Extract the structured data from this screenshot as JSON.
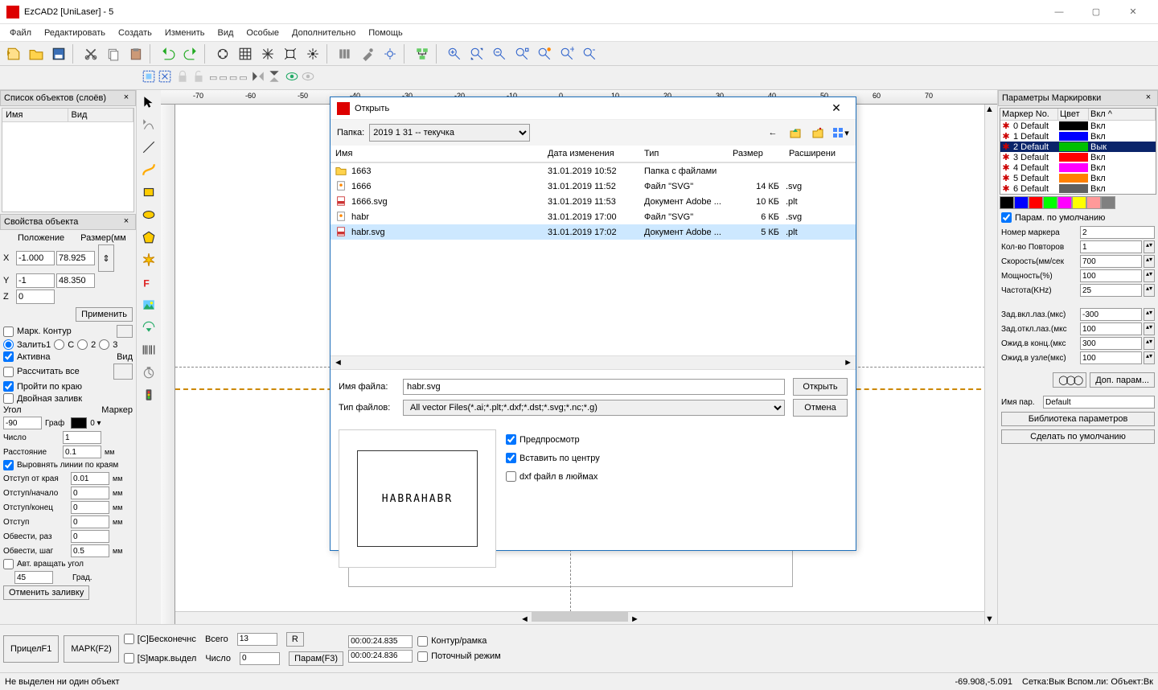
{
  "titlebar": {
    "title": "EzCAD2 [UniLaser] - 5"
  },
  "menubar": [
    "Файл",
    "Редактировать",
    "Создать",
    "Изменить",
    "Вид",
    "Особые",
    "Дополнительно",
    "Помощь"
  ],
  "left": {
    "panel1_title": "Список объектов (слоёв)",
    "cols": {
      "c1": "Имя",
      "c2": "Вид"
    },
    "panel2_title": "Свойства объекта",
    "pos_hdr": "Положение",
    "size_hdr": "Размер(мм",
    "x_label": "X",
    "y_label": "Y",
    "z_label": "Z",
    "x_val": "-1.000",
    "y_val": "-1",
    "z_val": "0",
    "w_val": "78.925",
    "h_val": "48.350",
    "apply_btn": "Применить",
    "mark_contour": "Марк. Контур",
    "fill1": "Залить1",
    "fill_c": "С",
    "fill2": "2",
    "fill3": "3",
    "active": "Активна",
    "view_lbl": "Вид",
    "calc_all": "Рассчитать все",
    "along_edge": "Пройти по краю",
    "double_fill": "Двойная заливк",
    "angle_lbl": "Угол",
    "marker_lbl": "Маркер",
    "angle_val": "-90",
    "graf_lbl": "Граф",
    "number_lbl": "Число",
    "number_val": "1",
    "distance_lbl": "Расстояние",
    "distance_val": "0.1",
    "align_lines": "Выровнять линии по краям",
    "edge_off": "Отступ от края",
    "edge_off_val": "0.01",
    "start_off": "Отступ/начало",
    "start_off_val": "0",
    "end_off": "Отступ/конец",
    "end_off_val": "0",
    "indent": "Отступ",
    "indent_val": "0",
    "circle_times": "Обвести, раз",
    "circle_times_val": "0",
    "circle_step": "Обвести, шаг",
    "circle_step_val": "0.5",
    "auto_rotate": "Авт. вращать угол",
    "rotate_val": "45",
    "grad_lbl": "Град.",
    "cancel_fill": "Отменить заливку",
    "mm": "мм"
  },
  "dialog": {
    "title": "Открыть",
    "folder_lbl": "Папка:",
    "folder_val": "2019 1 31 -- текучка",
    "hdr_name": "Имя",
    "hdr_date": "Дата изменения",
    "hdr_type": "Тип",
    "hdr_size": "Размер",
    "hdr_ext": "Расширени",
    "files": [
      {
        "icon": "folder",
        "name": "1663",
        "date": "31.01.2019 10:52",
        "type": "Папка с файлами",
        "size": "",
        "ext": ""
      },
      {
        "icon": "svg",
        "name": "1666",
        "date": "31.01.2019 11:52",
        "type": "Файл \"SVG\"",
        "size": "14 КБ",
        "ext": ".svg"
      },
      {
        "icon": "pdf",
        "name": "1666.svg",
        "date": "31.01.2019 11:53",
        "type": "Документ Adobe ...",
        "size": "10 КБ",
        "ext": ".plt"
      },
      {
        "icon": "svg",
        "name": "habr",
        "date": "31.01.2019 17:00",
        "type": "Файл \"SVG\"",
        "size": "6 КБ",
        "ext": ".svg"
      },
      {
        "icon": "pdf",
        "name": "habr.svg",
        "date": "31.01.2019 17:02",
        "type": "Документ Adobe ...",
        "size": "5 КБ",
        "ext": ".plt"
      }
    ],
    "selected_index": 4,
    "fname_lbl": "Имя файла:",
    "fname_val": "habr.svg",
    "ftype_lbl": "Тип файлов:",
    "ftype_val": "All vector Files(*.ai;*.plt;*.dxf;*.dst;*.svg;*.nc;*.g)",
    "open_btn": "Открыть",
    "cancel_btn": "Отмена",
    "opt_preview": "Предпросмотр",
    "opt_center": "Вставить по центру",
    "opt_dxf": "dxf файл в люймах",
    "preview_text": "HABRAHABR"
  },
  "right": {
    "title": "Параметры Маркировки",
    "hdr_no": "Маркер No.",
    "hdr_color": "Цвет",
    "hdr_en": "Вкл ^",
    "markers": [
      {
        "name": "0 Default",
        "color": "#000000",
        "en": "Вкл"
      },
      {
        "name": "1 Default",
        "color": "#0000ff",
        "en": "Вкл"
      },
      {
        "name": "2 Default",
        "color": "#00c000",
        "en": "Вык"
      },
      {
        "name": "3 Default",
        "color": "#ff0000",
        "en": "Вкл"
      },
      {
        "name": "4 Default",
        "color": "#ff00ff",
        "en": "Вкл"
      },
      {
        "name": "5 Default",
        "color": "#ff8000",
        "en": "Вкл"
      },
      {
        "name": "6 Default",
        "color": "#606060",
        "en": "Вкл"
      }
    ],
    "sel_index": 2,
    "colors": [
      "#000000",
      "#0000ff",
      "#ff0000",
      "#00ff00",
      "#ff00ff",
      "#ffff00",
      "#ff9999",
      "#808080"
    ],
    "default_param": "Парам. по умолчанию",
    "marker_no_lbl": "Номер маркера",
    "marker_no_val": "2",
    "repeat_lbl": "Кол-во Повторов",
    "repeat_val": "1",
    "speed_lbl": "Скорость(мм/сек",
    "speed_val": "700",
    "power_lbl": "Мощность(%)",
    "power_val": "100",
    "freq_lbl": "Частота(KHz)",
    "freq_val": "25",
    "laser_on_lbl": "Зад.вкл.лаз.(мкс)",
    "laser_on_val": "-300",
    "laser_off_lbl": "Зад.откл.лаз.(мкс",
    "laser_off_val": "100",
    "wait_end_lbl": "Ожид.в конц.(мкс",
    "wait_end_val": "300",
    "wait_node_lbl": "Ожид.в узле(мкс)",
    "wait_node_val": "100",
    "extra_param_btn": "Доп. парам...",
    "name_lbl": "Имя пар.",
    "name_val": "Default",
    "lib_btn": "Библиотека параметров",
    "default_btn": "Сделать по умолчанию",
    "rings_icon": "◯◯◯"
  },
  "bottom": {
    "aim_btn": "ПрицелF1",
    "mark_btn": "МАРК(F2)",
    "infinite_lbl": "[С]Бесконечнс",
    "total_lbl": "Всего",
    "total_val": "13",
    "r_lbl": "R",
    "mark_sel_lbl": "[S]марк.выдел",
    "count_lbl": "Число",
    "count_val": "0",
    "param_btn": "Парам(F3)",
    "time1": "00:00:24.835",
    "time2": "00:00:24.836",
    "contour_lbl": "Контур/рамка",
    "stream_lbl": "Поточный режим"
  },
  "status": {
    "left": "Не выделен ни один объект",
    "coords": "-69.908,-5.091",
    "grid": "Сетка:Вык Вспом.ли: Объект:Вк"
  },
  "ruler_ticks": [
    "-70",
    "-60",
    "-50",
    "-40",
    "-30",
    "-20",
    "-10",
    "0",
    "10",
    "20",
    "30",
    "40",
    "50",
    "60",
    "70"
  ]
}
